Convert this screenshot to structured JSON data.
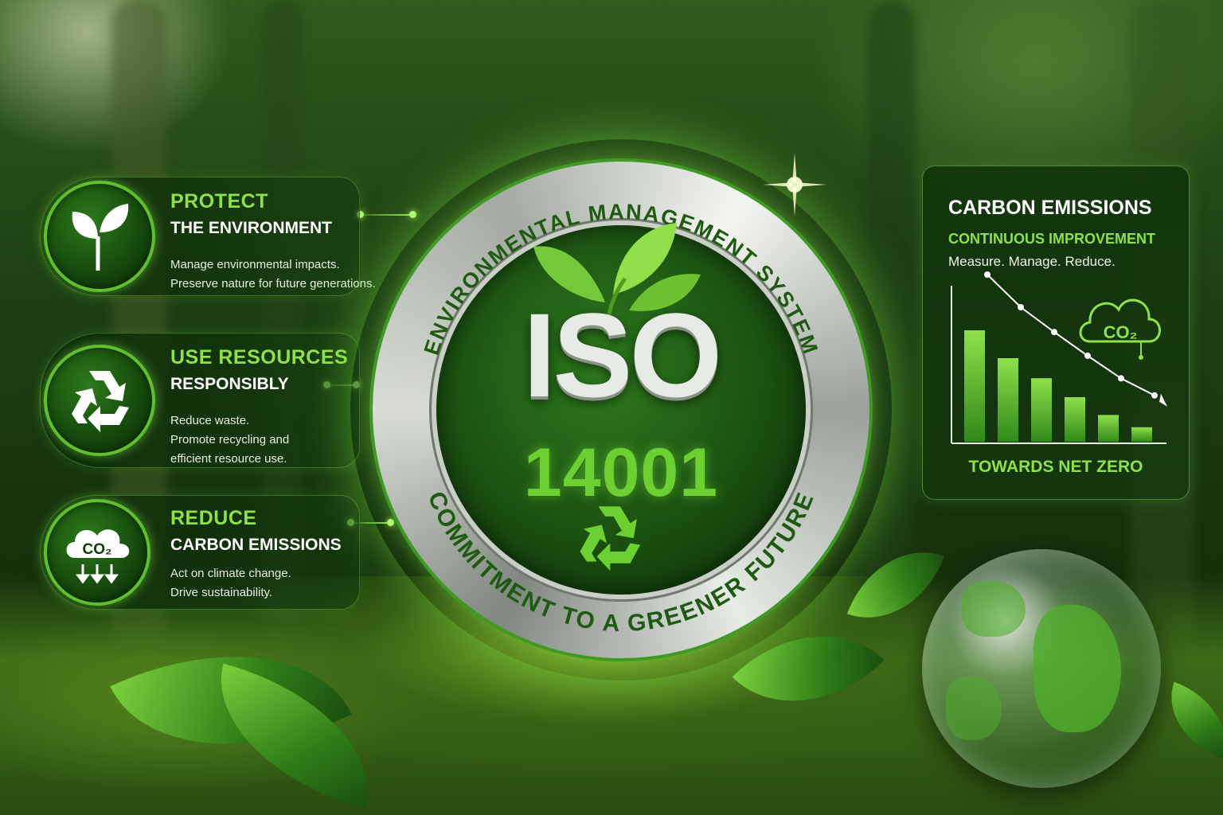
{
  "cards": [
    {
      "title": "PROTECT",
      "subtitle": "THE ENVIRONMENT",
      "lines": [
        "Manage environmental impacts.",
        "Preserve nature for future generations."
      ],
      "icon": "sprout-icon"
    },
    {
      "title": "USE RESOURCES",
      "subtitle": "RESPONSIBLY",
      "lines": [
        "Reduce waste.",
        "Promote recycling and",
        "efficient resource use."
      ],
      "icon": "recycle-icon"
    },
    {
      "title": "REDUCE",
      "subtitle": "CARBON EMISSIONS",
      "lines": [
        "Act on climate change.",
        "Drive sustainability."
      ],
      "icon": "co2-cloud-icon",
      "icon_label": "CO₂"
    }
  ],
  "badge": {
    "top_arc": "ENVIRONMENTAL MANAGEMENT SYSTEM",
    "bottom_arc": "COMMITMENT TO A GREENER FUTURE",
    "title": "ISO",
    "number": "14001"
  },
  "panel": {
    "title": "CARBON EMISSIONS",
    "subtitle": "CONTINUOUS IMPROVEMENT",
    "description": "Measure. Manage. Reduce.",
    "footer": "TOWARDS NET ZERO",
    "cloud_label": "CO₂"
  },
  "chart_data": {
    "type": "bar",
    "values": [
      100,
      75,
      57,
      40,
      24,
      13
    ],
    "trend": "decreasing"
  },
  "colors": {
    "accent": "#8fe04a",
    "dark_green": "#0f3b08",
    "silver": "#e7ebe6"
  }
}
